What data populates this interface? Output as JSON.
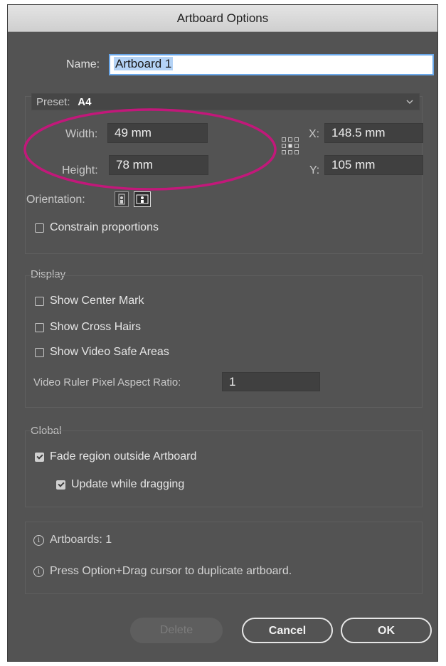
{
  "dialog": {
    "title": "Artboard Options"
  },
  "name": {
    "label": "Name:",
    "value": "Artboard 1"
  },
  "preset": {
    "label": "Preset:",
    "value": "A4"
  },
  "size": {
    "width_label": "Width:",
    "width_value": "49  mm",
    "height_label": "Height:",
    "height_value": "78  mm"
  },
  "position": {
    "x_label": "X:",
    "x_value": "148.5 mm",
    "y_label": "Y:",
    "y_value": "105 mm"
  },
  "orientation": {
    "label": "Orientation:"
  },
  "constrain": {
    "label": "Constrain proportions",
    "checked": false
  },
  "display": {
    "title": "Display",
    "center_mark": "Show Center Mark",
    "cross_hairs": "Show Cross Hairs",
    "video_safe": "Show Video Safe Areas",
    "ratio_label": "Video Ruler Pixel Aspect Ratio:",
    "ratio_value": "1"
  },
  "global": {
    "title": "Global",
    "fade_region": "Fade region outside Artboard",
    "fade_checked": true,
    "update_dragging": "Update while dragging",
    "update_checked": true
  },
  "info": {
    "artboards": "Artboards: 1",
    "tip": "Press Option+Drag cursor to duplicate artboard."
  },
  "buttons": {
    "delete": "Delete",
    "cancel": "Cancel",
    "ok": "OK"
  },
  "colors": {
    "dialog_bg": "#535353",
    "annotation": "#c2187a",
    "focus_ring": "#6aa8ea"
  },
  "icons": {
    "reference_point": "reference-point-grid-icon",
    "info": "info-icon",
    "dropdown": "chevron-down-icon"
  }
}
